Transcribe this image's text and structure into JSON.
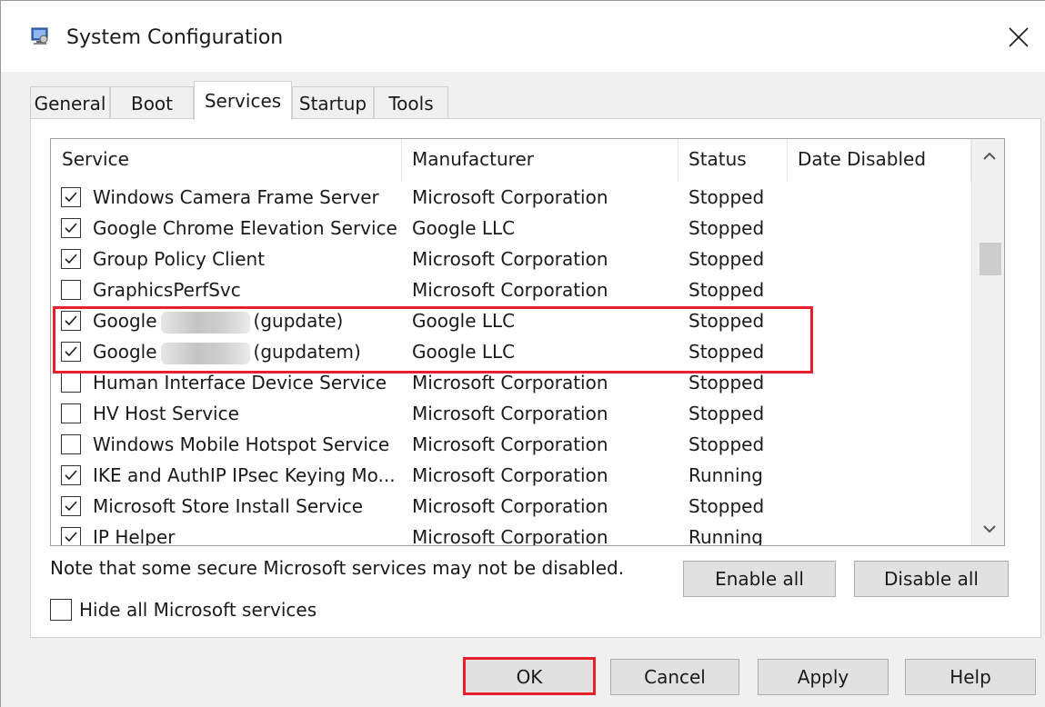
{
  "window": {
    "title": "System Configuration",
    "close_glyph": "✕"
  },
  "tabs": [
    {
      "label": "General",
      "active": false
    },
    {
      "label": "Boot",
      "active": false
    },
    {
      "label": "Services",
      "active": true
    },
    {
      "label": "Startup",
      "active": false
    },
    {
      "label": "Tools",
      "active": false
    }
  ],
  "list": {
    "columns": {
      "service": "Service",
      "manufacturer": "Manufacturer",
      "status": "Status",
      "date_disabled": "Date Disabled"
    },
    "rows": [
      {
        "checked": true,
        "service": "Windows Camera Frame Server",
        "manufacturer": "Microsoft Corporation",
        "status": "Stopped"
      },
      {
        "checked": true,
        "service": "Google Chrome Elevation Service",
        "manufacturer": "Google LLC",
        "status": "Stopped"
      },
      {
        "checked": true,
        "service": "Group Policy Client",
        "manufacturer": "Microsoft Corporation",
        "status": "Stopped"
      },
      {
        "checked": false,
        "service": "GraphicsPerfSvc",
        "manufacturer": "Microsoft Corporation",
        "status": "Stopped"
      },
      {
        "checked": true,
        "service_prefix": "Google",
        "service_suffix": "(gupdate)",
        "manufacturer": "Google LLC",
        "status": "Stopped"
      },
      {
        "checked": true,
        "service_prefix": "Google",
        "service_suffix": "(gupdatem)",
        "manufacturer": "Google LLC",
        "status": "Stopped"
      },
      {
        "checked": false,
        "service": "Human Interface Device Service",
        "manufacturer": "Microsoft Corporation",
        "status": "Stopped"
      },
      {
        "checked": false,
        "service": "HV Host Service",
        "manufacturer": "Microsoft Corporation",
        "status": "Stopped"
      },
      {
        "checked": false,
        "service": "Windows Mobile Hotspot Service",
        "manufacturer": "Microsoft Corporation",
        "status": "Stopped"
      },
      {
        "checked": true,
        "service": "IKE and AuthIP IPsec Keying Mo...",
        "manufacturer": "Microsoft Corporation",
        "status": "Running"
      },
      {
        "checked": true,
        "service": "Microsoft Store Install Service",
        "manufacturer": "Microsoft Corporation",
        "status": "Stopped"
      },
      {
        "checked": true,
        "service": "IP Helper",
        "manufacturer": "Microsoft Corporation",
        "status": "Running"
      }
    ]
  },
  "note": "Note that some secure Microsoft services may not be disabled.",
  "buttons": {
    "enable_all": "Enable all",
    "disable_all": "Disable all",
    "ok": "OK",
    "cancel": "Cancel",
    "apply": "Apply",
    "help": "Help"
  },
  "hide_ms": {
    "label": "Hide all Microsoft services",
    "checked": false
  },
  "colors": {
    "highlight": "#e8202a",
    "window_bg": "#f0f0f0",
    "button_bg": "#e1e1e1"
  }
}
